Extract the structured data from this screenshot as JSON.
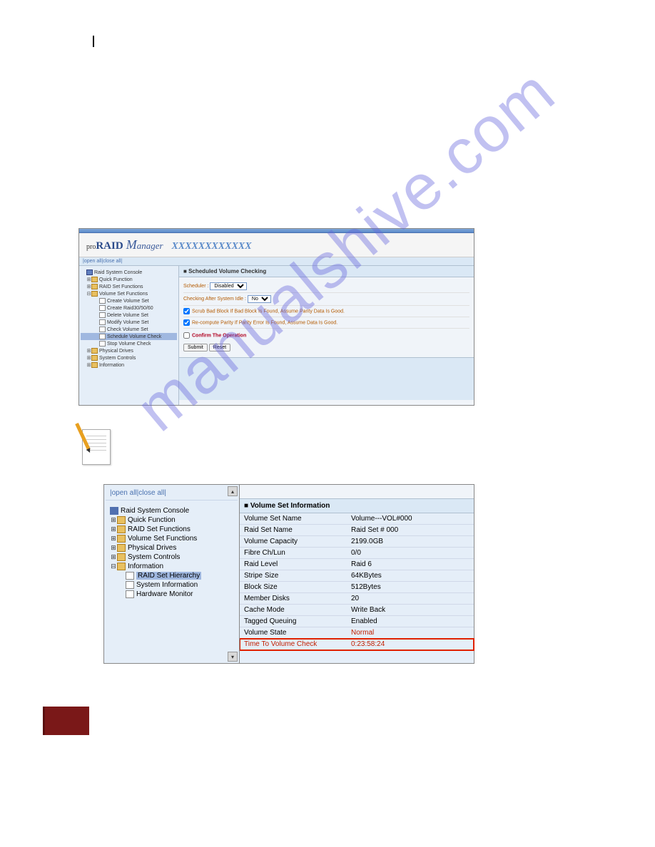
{
  "logo": {
    "pro": "pro",
    "raid": "RAID",
    "m": "M",
    "anager": "anager",
    "x": "XXXXXXXXXXXX"
  },
  "toolbar1": {
    "open": "open all",
    "close": "close all"
  },
  "tree1": {
    "console": "Raid System Console",
    "quick": "Quick Function",
    "raidset": "RAID Set Functions",
    "volset": "Volume Set Functions",
    "create": "Create Volume Set",
    "create30": "Create Raid30/50/60",
    "delete": "Delete Volume Set",
    "modify": "Modify Volume Set",
    "check": "Check Volume Set",
    "schedule": "Schedule Volume Check",
    "stop": "Stop Volume Check",
    "physical": "Physical Drives",
    "system": "System Controls",
    "info": "Information"
  },
  "panel1": {
    "title": "Scheduled Volume Checking",
    "scheduler_label": "Scheduler :",
    "scheduler_value": "Disabled",
    "idle_label": "Checking After System Idle :",
    "idle_value": "No",
    "row1": "Scrub Bad Block If Bad Block Is Found, Assume Parity Data Is Good.",
    "row2": "Re-compute Parity If Parity Error Is Found, Assume Data Is Good.",
    "confirm": "Confirm The Operation",
    "submit": "Submit",
    "reset": "Reset"
  },
  "toolbar2": {
    "open": "open all",
    "close": "close all"
  },
  "tree2": {
    "console": "Raid System Console",
    "quick": "Quick Function",
    "raidset": "RAID Set Functions",
    "volset": "Volume Set Functions",
    "physical": "Physical Drives",
    "system": "System Controls",
    "info": "Information",
    "hierarchy": "RAID Set Hierarchy",
    "sysinfo": "System Information",
    "hardware": "Hardware Monitor"
  },
  "panel2": {
    "title": "Volume Set Information",
    "rows": [
      {
        "k": "Volume Set Name",
        "v": "Volume---VOL#000"
      },
      {
        "k": "Raid Set Name",
        "v": "Raid Set # 000"
      },
      {
        "k": "Volume Capacity",
        "v": "2199.0GB"
      },
      {
        "k": "Fibre Ch/Lun",
        "v": "0/0"
      },
      {
        "k": "Raid Level",
        "v": "Raid 6"
      },
      {
        "k": "Stripe Size",
        "v": "64KBytes"
      },
      {
        "k": "Block Size",
        "v": "512Bytes"
      },
      {
        "k": "Member Disks",
        "v": "20"
      },
      {
        "k": "Cache Mode",
        "v": "Write Back"
      },
      {
        "k": "Tagged Queuing",
        "v": "Enabled"
      },
      {
        "k": "Volume State",
        "v": "Normal"
      },
      {
        "k": "Time To Volume Check",
        "v": "0:23:58:24"
      }
    ]
  },
  "watermark": "manualshive.com"
}
